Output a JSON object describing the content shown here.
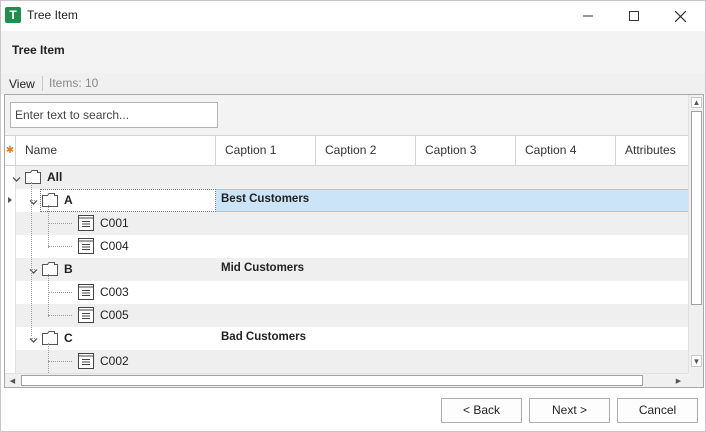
{
  "window": {
    "icon_letter": "T",
    "title": "Tree Item",
    "controls": {
      "minimize": "minimize-icon",
      "maximize": "maximize-icon",
      "close": "close-icon"
    }
  },
  "header": {
    "title": "Tree Item"
  },
  "viewbar": {
    "view_label": "View",
    "items_label": "Items: 10"
  },
  "search": {
    "placeholder": "Enter text to search..."
  },
  "columns": [
    "Name",
    "Caption 1",
    "Caption 2",
    "Caption 3",
    "Caption 4",
    "Attributes"
  ],
  "tree": [
    {
      "name": "All",
      "level": 0,
      "type": "folder",
      "bold": true,
      "caption1": ""
    },
    {
      "name": "A",
      "level": 1,
      "type": "folder",
      "bold": true,
      "caption1": "Best Customers",
      "selected": true
    },
    {
      "name": "C001",
      "level": 2,
      "type": "document",
      "bold": false,
      "caption1": ""
    },
    {
      "name": "C004",
      "level": 2,
      "type": "document",
      "bold": false,
      "caption1": ""
    },
    {
      "name": "B",
      "level": 1,
      "type": "folder",
      "bold": true,
      "caption1": "Mid Customers"
    },
    {
      "name": "C003",
      "level": 2,
      "type": "document",
      "bold": false,
      "caption1": ""
    },
    {
      "name": "C005",
      "level": 2,
      "type": "document",
      "bold": false,
      "caption1": ""
    },
    {
      "name": "C",
      "level": 1,
      "type": "folder",
      "bold": true,
      "caption1": "Bad Customers"
    },
    {
      "name": "C002",
      "level": 2,
      "type": "document",
      "bold": false,
      "caption1": ""
    }
  ],
  "buttons": {
    "back": "< Back",
    "next": "Next >",
    "cancel": "Cancel"
  },
  "colors": {
    "accent_green": "#1e8f4e",
    "selection": "#cce4f7",
    "new_row_star": "#e67e22"
  }
}
